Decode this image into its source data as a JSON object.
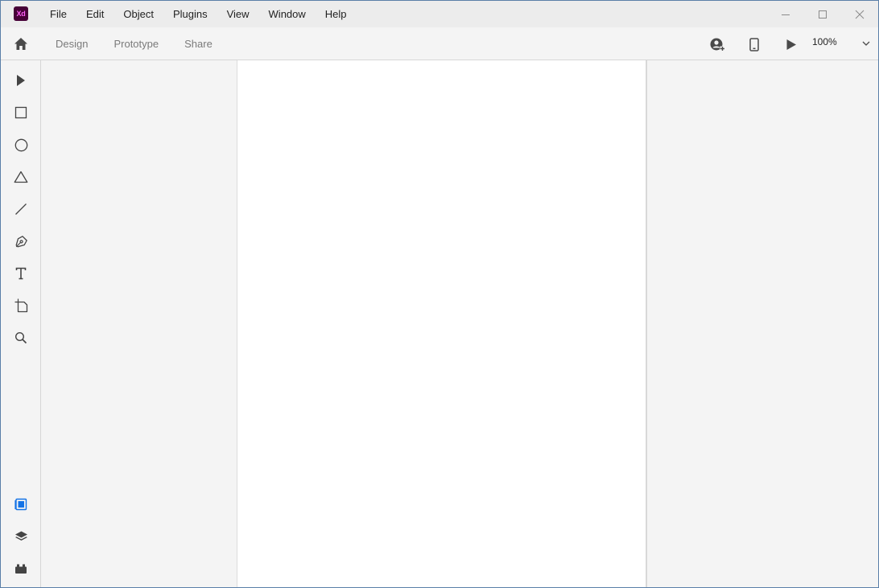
{
  "app": {
    "logo_text": "Xd",
    "brand_color": "#470137",
    "logo_text_color": "#ff61f6"
  },
  "menu": {
    "items": [
      "File",
      "Edit",
      "Object",
      "Plugins",
      "View",
      "Window",
      "Help"
    ]
  },
  "window_controls": {
    "icons": [
      "minimize-icon",
      "maximize-icon",
      "close-icon"
    ]
  },
  "toolbar": {
    "home_icon": "home-icon",
    "tabs": [
      "Design",
      "Prototype",
      "Share"
    ],
    "right_icons": [
      "user-share-icon",
      "device-preview-icon",
      "play-icon"
    ],
    "zoom": "100%"
  },
  "tools": {
    "top": [
      "select-icon",
      "rectangle-icon",
      "ellipse-icon",
      "polygon-icon",
      "line-icon",
      "pen-icon",
      "text-icon",
      "artboard-icon",
      "zoom-icon"
    ],
    "bottom": [
      "assets-icon",
      "layers-icon",
      "plugins-icon"
    ],
    "active_color": "#1473e6"
  }
}
